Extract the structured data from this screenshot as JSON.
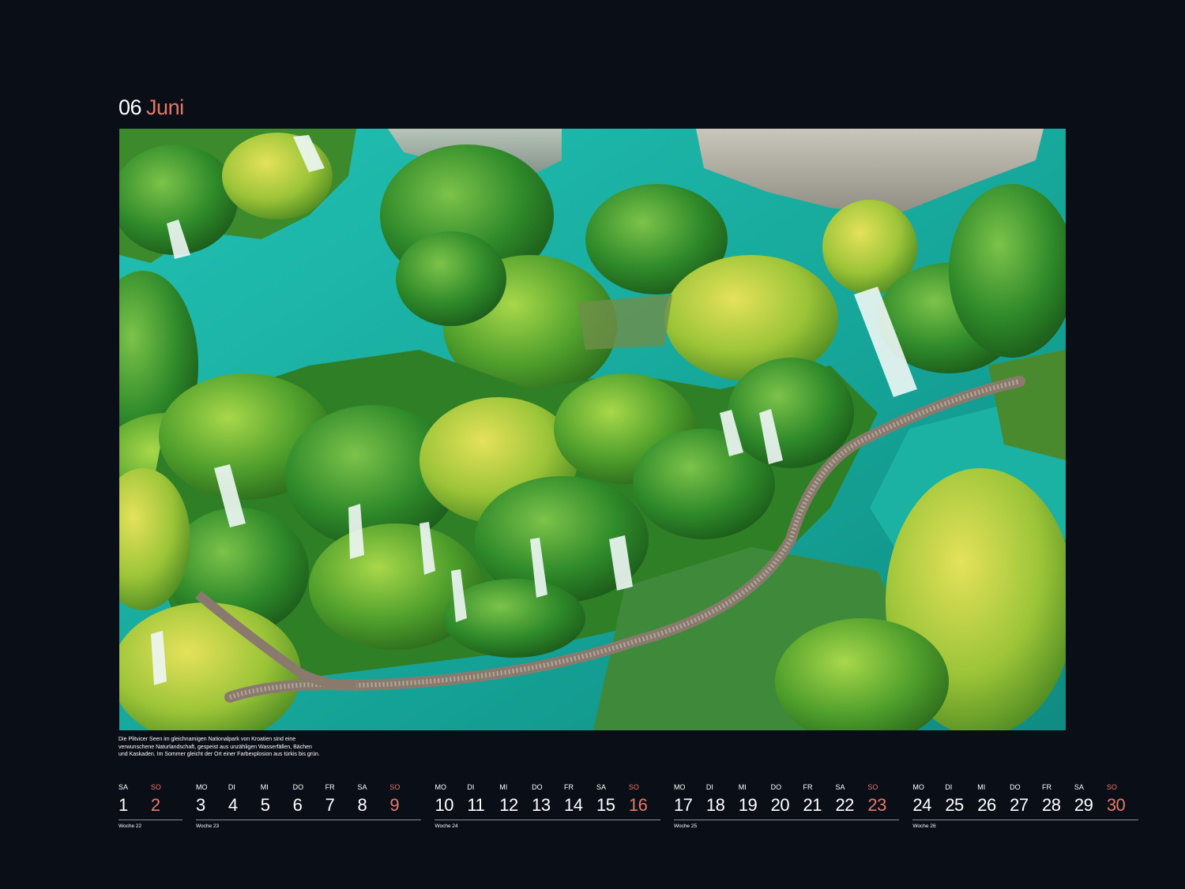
{
  "header": {
    "number": "06",
    "month": "Juni"
  },
  "caption": {
    "lines": [
      "Die Plitvicer Seen im gleichnamigen Nationalpark von Kroatien sind eine",
      "verwunschene Naturlandschaft, gespeist aus unzähligen Wasserfällen, Bächen",
      "und Kaskaden. Im Sommer gleicht der Ort einer Farbexplosion aus türkis bis grün."
    ]
  },
  "colors": {
    "sunday": "#e8776a",
    "background": "#0a0f17",
    "water": "#1fb3a5"
  },
  "calendar": {
    "days": [
      {
        "wd": "SA",
        "d": "1",
        "sun": false
      },
      {
        "wd": "SO",
        "d": "2",
        "sun": true
      },
      {
        "wd": "MO",
        "d": "3",
        "sun": false
      },
      {
        "wd": "DI",
        "d": "4",
        "sun": false
      },
      {
        "wd": "MI",
        "d": "5",
        "sun": false
      },
      {
        "wd": "DO",
        "d": "6",
        "sun": false
      },
      {
        "wd": "FR",
        "d": "7",
        "sun": false
      },
      {
        "wd": "SA",
        "d": "8",
        "sun": false
      },
      {
        "wd": "SO",
        "d": "9",
        "sun": true
      },
      {
        "wd": "MO",
        "d": "10",
        "sun": false
      },
      {
        "wd": "DI",
        "d": "11",
        "sun": false
      },
      {
        "wd": "MI",
        "d": "12",
        "sun": false
      },
      {
        "wd": "DO",
        "d": "13",
        "sun": false
      },
      {
        "wd": "FR",
        "d": "14",
        "sun": false
      },
      {
        "wd": "SA",
        "d": "15",
        "sun": false
      },
      {
        "wd": "SO",
        "d": "16",
        "sun": true
      },
      {
        "wd": "MO",
        "d": "17",
        "sun": false
      },
      {
        "wd": "DI",
        "d": "18",
        "sun": false
      },
      {
        "wd": "MI",
        "d": "19",
        "sun": false
      },
      {
        "wd": "DO",
        "d": "20",
        "sun": false
      },
      {
        "wd": "FR",
        "d": "21",
        "sun": false
      },
      {
        "wd": "SA",
        "d": "22",
        "sun": false
      },
      {
        "wd": "SO",
        "d": "23",
        "sun": true
      },
      {
        "wd": "MO",
        "d": "24",
        "sun": false
      },
      {
        "wd": "DI",
        "d": "25",
        "sun": false
      },
      {
        "wd": "MI",
        "d": "26",
        "sun": false
      },
      {
        "wd": "DO",
        "d": "27",
        "sun": false
      },
      {
        "wd": "FR",
        "d": "28",
        "sun": false
      },
      {
        "wd": "SA",
        "d": "29",
        "sun": false
      },
      {
        "wd": "SO",
        "d": "30",
        "sun": true
      }
    ],
    "weeks": [
      {
        "label": "Woche 22"
      },
      {
        "label": "Woche 23"
      },
      {
        "label": "Woche 24"
      },
      {
        "label": "Woche 25"
      },
      {
        "label": "Woche 26"
      }
    ]
  }
}
